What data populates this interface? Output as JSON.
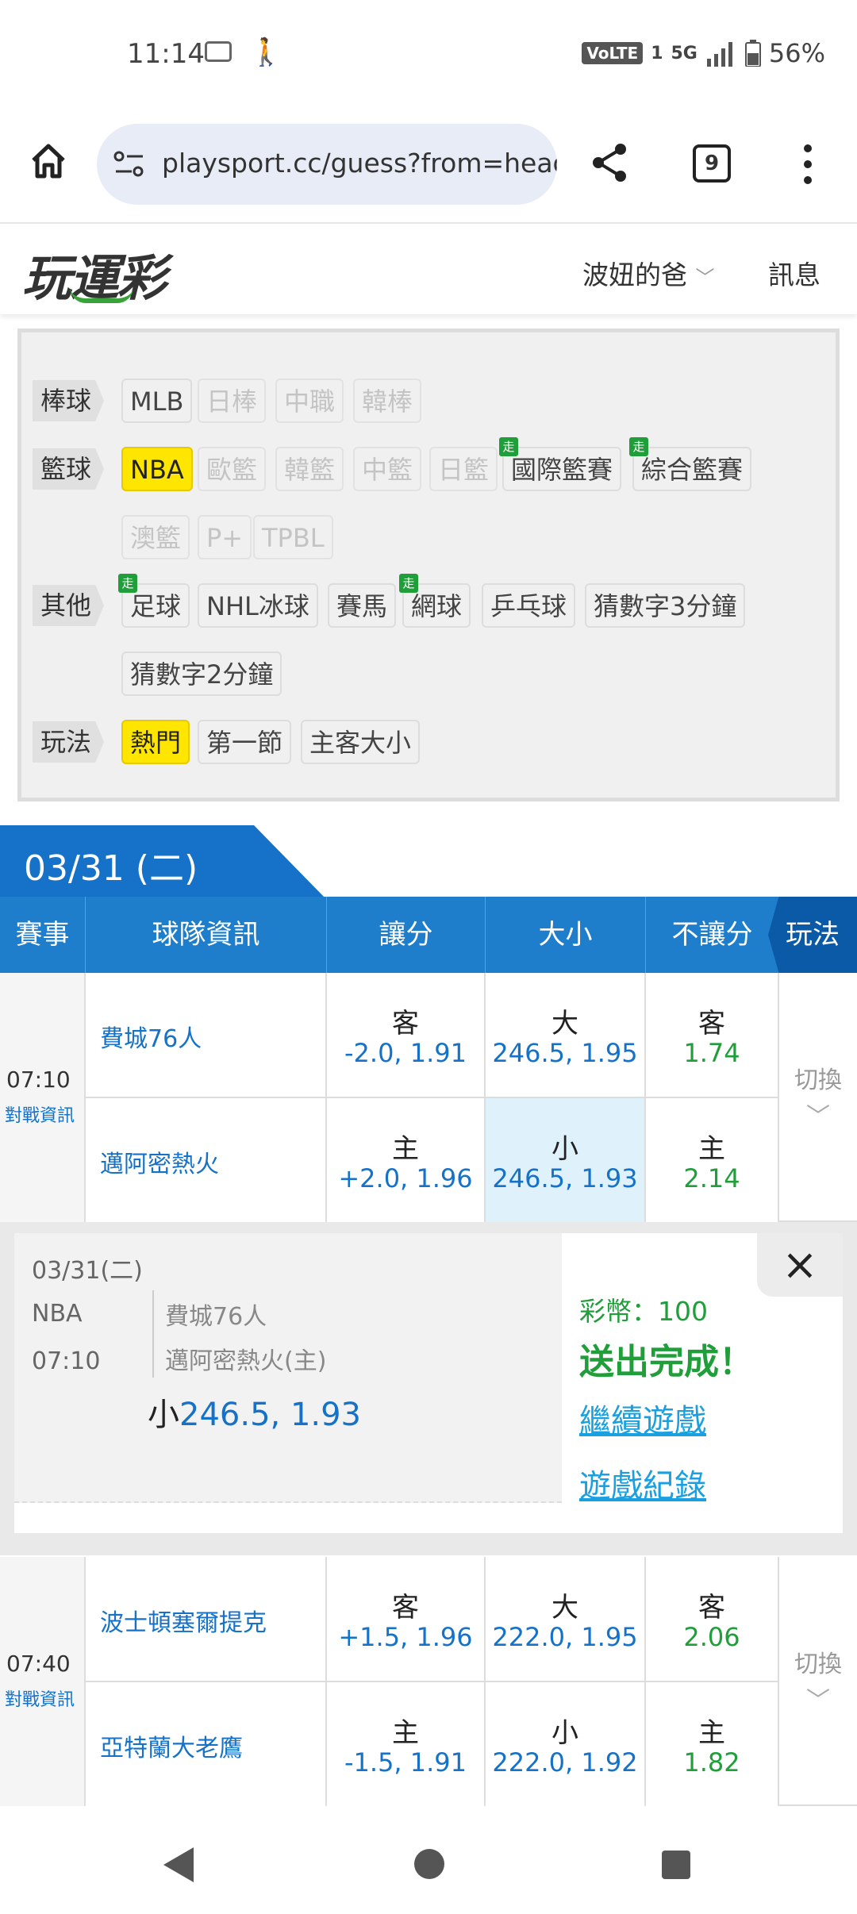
{
  "status_bar": {
    "time": "11:14",
    "network": "VoLTE",
    "sim": "1",
    "signal": "5G",
    "battery": "56%"
  },
  "browser": {
    "url": "playsport.cc/guess?from=head",
    "tab_count": "9"
  },
  "site_header": {
    "logo": "玩運彩",
    "user": "波妞的爸",
    "messages": "訊息"
  },
  "filters": {
    "baseball": {
      "label": "棒球",
      "items": [
        "MLB",
        "日棒",
        "中職",
        "韓棒"
      ]
    },
    "basketball": {
      "label": "籃球",
      "items": [
        "NBA",
        "歐籃",
        "韓籃",
        "中籃",
        "日籃",
        "國際籃賽",
        "綜合籃賽",
        "澳籃",
        "P+",
        "TPBL"
      ]
    },
    "other": {
      "label": "其他",
      "items": [
        "足球",
        "NHL冰球",
        "賽馬",
        "網球",
        "乒乓球",
        "猜數字3分鐘",
        "猜數字2分鐘"
      ]
    },
    "play": {
      "label": "玩法",
      "items": [
        "熱門",
        "第一節",
        "主客大小"
      ]
    },
    "walk_badge": "走"
  },
  "date_tab": "03/31 (二)",
  "table_header": {
    "event": "賽事",
    "team_info": "球隊資訊",
    "spread": "讓分",
    "total": "大小",
    "moneyline": "不讓分",
    "play": "玩法"
  },
  "matches": [
    {
      "time": "07:10",
      "info": "對戰資訊",
      "switch": "切換",
      "away": {
        "team": "費城76人",
        "spread_side": "客",
        "spread": "-2.0, 1.91",
        "total_side": "大",
        "total": "246.5, 1.95",
        "ml_side": "客",
        "ml": "1.74"
      },
      "home": {
        "team": "邁阿密熱火",
        "spread_side": "主",
        "spread": "+2.0, 1.96",
        "total_side": "小",
        "total": "246.5, 1.93",
        "ml_side": "主",
        "ml": "2.14"
      }
    },
    {
      "time": "07:40",
      "info": "對戰資訊",
      "switch": "切換",
      "away": {
        "team": "波士頓塞爾提克",
        "spread_side": "客",
        "spread": "+1.5, 1.96",
        "total_side": "大",
        "total": "222.0, 1.95",
        "ml_side": "客",
        "ml": "2.06"
      },
      "home": {
        "team": "亞特蘭大老鷹",
        "spread_side": "主",
        "spread": "-1.5, 1.91",
        "total_side": "小",
        "total": "222.0, 1.92",
        "ml_side": "主",
        "ml": "1.82"
      }
    }
  ],
  "confirmation": {
    "date": "03/31(二)",
    "league": "NBA",
    "time": "07:10",
    "away": "費城76人",
    "home": "邁阿密熱火(主)",
    "pick_side": "小",
    "pick_value": "246.5, 1.93",
    "coins": "彩幣：100",
    "done": "送出完成！",
    "continue": "繼續遊戲",
    "history": "遊戲紀錄",
    "close": "×"
  },
  "colors": {
    "primary_blue": "#1f7ecb",
    "green": "#1f9e3a",
    "highlight": "#ffe600",
    "link": "#1aa0e0"
  }
}
